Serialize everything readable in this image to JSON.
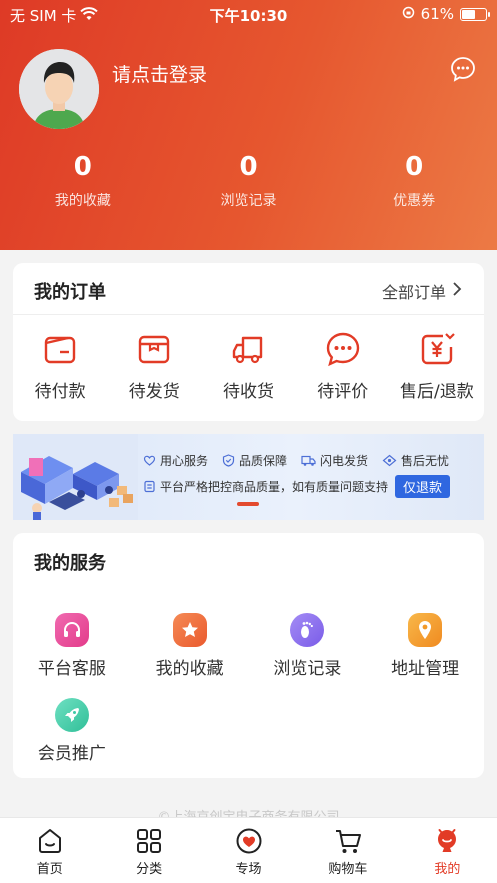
{
  "status_bar": {
    "carrier": "无 SIM 卡",
    "time": "下午10:30",
    "battery": "61%",
    "battery_level": 0.61
  },
  "header": {
    "login_prompt": "请点击登录"
  },
  "stats": [
    {
      "value": "0",
      "label": "我的收藏"
    },
    {
      "value": "0",
      "label": "浏览记录"
    },
    {
      "value": "0",
      "label": "优惠券"
    }
  ],
  "orders": {
    "title": "我的订单",
    "all_label": "全部订单",
    "items": [
      {
        "label": "待付款",
        "icon": "wallet-icon"
      },
      {
        "label": "待发货",
        "icon": "box-icon"
      },
      {
        "label": "待收货",
        "icon": "truck-icon"
      },
      {
        "label": "待评价",
        "icon": "comment-icon"
      },
      {
        "label": "售后/退款",
        "icon": "refund-icon"
      }
    ]
  },
  "banner": {
    "tags": [
      "用心服务",
      "品质保障",
      "闪电发货",
      "售后无忧"
    ],
    "description": "平台严格把控商品质量，如有质量问题支持",
    "button": "仅退款"
  },
  "services": {
    "title": "我的服务",
    "items": [
      {
        "label": "平台客服",
        "icon": "headset-icon",
        "color": "#e8409a"
      },
      {
        "label": "我的收藏",
        "icon": "star-icon",
        "color": "#f06a3c"
      },
      {
        "label": "浏览记录",
        "icon": "footprint-icon",
        "color": "#8a6cf0"
      },
      {
        "label": "地址管理",
        "icon": "location-pin-icon",
        "color": "#f59a2a"
      },
      {
        "label": "会员推广",
        "icon": "rocket-icon",
        "color": "#3fc9a6"
      }
    ]
  },
  "footer": "©上海京创宝电子商务有限公司",
  "tabbar": [
    {
      "label": "首页",
      "icon": "home-icon"
    },
    {
      "label": "分类",
      "icon": "category-icon"
    },
    {
      "label": "专场",
      "icon": "special-heart-icon"
    },
    {
      "label": "购物车",
      "icon": "cart-icon"
    },
    {
      "label": "我的",
      "icon": "profile-icon",
      "active": true
    }
  ],
  "colors": {
    "accent": "#e23b26",
    "header_start": "#de3a26",
    "header_end": "#ec7a45"
  }
}
